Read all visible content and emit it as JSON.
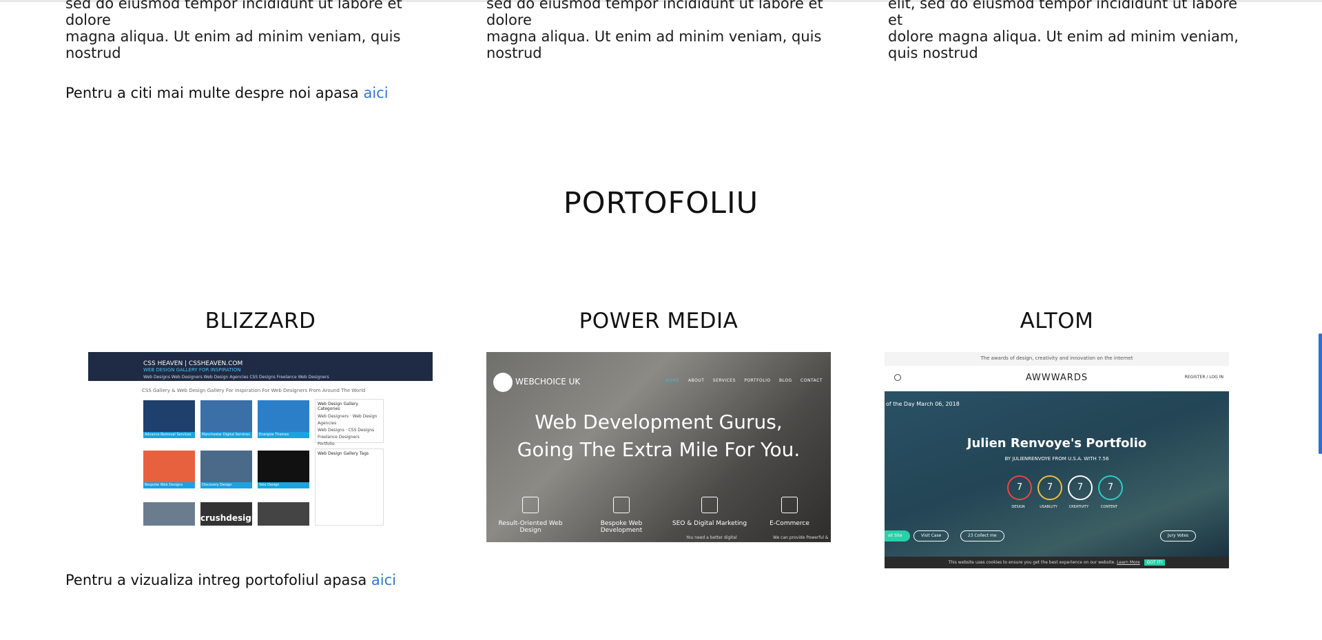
{
  "about": {
    "columns": [
      [
        "sed do eiusmod tempor incididunt ut labore et dolore",
        "magna aliqua. Ut enim ad minim veniam, quis nostrud"
      ],
      [
        "sed do eiusmod tempor incididunt ut labore et dolore",
        "magna aliqua. Ut enim ad minim veniam, quis nostrud"
      ],
      [
        "elit, sed do eiusmod tempor incididunt ut labore et",
        "dolore magna aliqua. Ut enim ad minim veniam,",
        "quis nostrud"
      ]
    ],
    "more_text": "Pentru a citi mai multe despre noi apasa ",
    "more_link": "aici"
  },
  "portfolio": {
    "title": "PORTOFOLIU",
    "projects": [
      {
        "name": "BLIZZARD",
        "shot": {
          "brand": "CSS HEAVEN | CSSHEAVEN.COM",
          "tagline": "WEB DESIGN GALLERY FOR INSPIRATION",
          "nav": "Web Designs   Web Designers   Web Design Agencies   CSS Designs   Freelance Web Designers",
          "subtitle": "CSS Gallery & Web Design Gallery For Inspiration For Web Designers From Around The World",
          "thumb_captions": [
            "Advance Removal Services",
            "Manchester Digital Services",
            "Energize Themes",
            "Bespoke Web Designs",
            "Discovery Design",
            "Volo Design"
          ],
          "side_titles": [
            "Web Design Gallery Categories",
            "Web Design Gallery Tags"
          ],
          "side_items": [
            "Web Designers",
            "Web Design Agencies",
            "Web Designs",
            "CSS Designs",
            "Freelance Designers",
            "Portfolio"
          ],
          "crush": "crushdesign"
        }
      },
      {
        "name": "POWER MEDIA",
        "shot": {
          "logo": "WEBCHOICE UK",
          "menu": [
            "HOME",
            "ABOUT",
            "SERVICES",
            "PORTFOLIO",
            "BLOG",
            "CONTACT"
          ],
          "hero_line1": "Web Development Gurus,",
          "hero_line2": "Going The Extra Mile For You.",
          "features": [
            "Result-Oriented Web Design",
            "Bespoke Web Development",
            "SEO & Digital Marketing",
            "E-Commerce"
          ],
          "tiny_left": "You need a better digital",
          "tiny_right": "We can provide Powerful &"
        }
      },
      {
        "name": "ALTOM",
        "shot": {
          "top_text": "The awards of design, creativity and innovation on the internet",
          "logo": "AWWWARDS",
          "register": "REGISTER / LOG IN",
          "day": "of the Day  March 06, 2018",
          "site_name": "Julien Renvoye's Portfolio",
          "by_line": "BY JULIENRENVOYE FROM U.S.A. WITH 7.56",
          "scores": [
            "7",
            "7",
            "7",
            "7"
          ],
          "score_labels": [
            "DESIGN",
            "USABILITY",
            "CREATIVITY",
            "CONTENT"
          ],
          "buttons": [
            "sit Site",
            "Visit Case",
            "23  Collect me",
            "Jury Votes"
          ],
          "cookie": "This website uses cookies to ensure you get the best experience on our website.",
          "learn": "Learn More",
          "got": "GOT IT!"
        }
      }
    ],
    "more_text": "Pentru a vizualiza intreg portofoliul apasa ",
    "more_link": "aici"
  }
}
